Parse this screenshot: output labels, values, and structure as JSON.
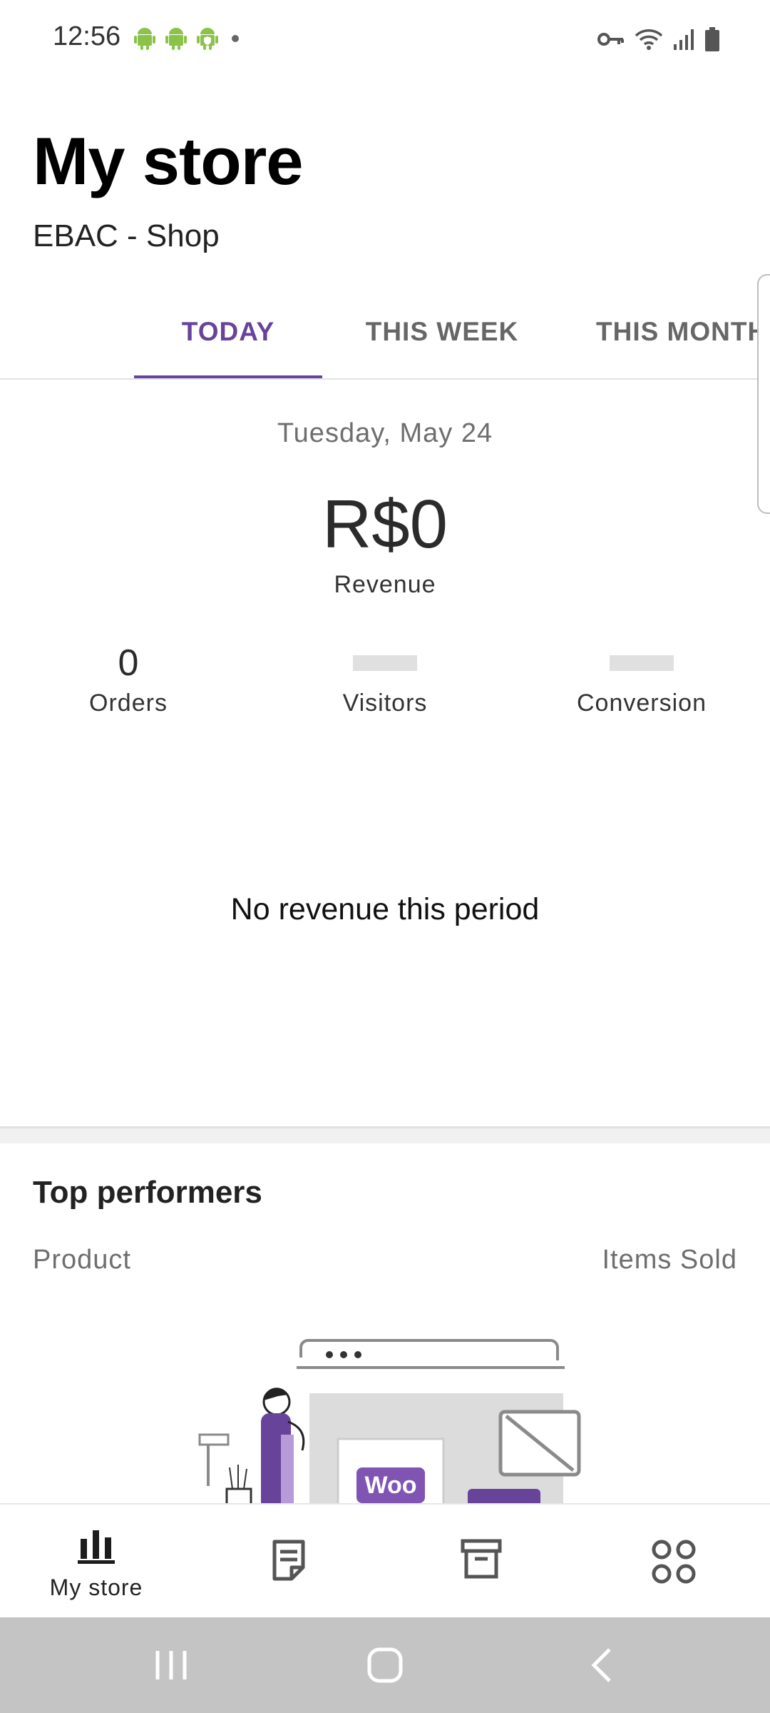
{
  "status_bar": {
    "time": "12:56",
    "left_icons": [
      "android-icon",
      "android-icon",
      "android-shield-icon",
      "dot-icon"
    ],
    "right_icons": [
      "key-icon",
      "wifi-icon",
      "signal-icon",
      "battery-icon"
    ]
  },
  "header": {
    "title": "My store",
    "store_name": "EBAC - Shop"
  },
  "tabs": [
    {
      "label": "TODAY",
      "active": true
    },
    {
      "label": "THIS WEEK",
      "active": false
    },
    {
      "label": "THIS MONTH",
      "active": false
    }
  ],
  "stats": {
    "date": "Tuesday, May 24",
    "revenue_value": "R$0",
    "revenue_label": "Revenue",
    "orders_value": "0",
    "orders_label": "Orders",
    "visitors_label": "Visitors",
    "conversion_label": "Conversion",
    "empty_message": "No revenue this period"
  },
  "top_performers": {
    "title": "Top performers",
    "col_product": "Product",
    "col_items_sold": "Items Sold",
    "illustration_badge": "Woo"
  },
  "bottom_nav": [
    {
      "label": "My store",
      "icon": "bar-chart-icon",
      "active": true
    },
    {
      "label": "",
      "icon": "orders-icon",
      "active": false
    },
    {
      "label": "",
      "icon": "products-icon",
      "active": false
    },
    {
      "label": "",
      "icon": "grid-menu-icon",
      "active": false
    }
  ],
  "colors": {
    "accent": "#674399",
    "muted_text": "#6e6e6e",
    "system_nav_bg": "#c4c4c4"
  }
}
